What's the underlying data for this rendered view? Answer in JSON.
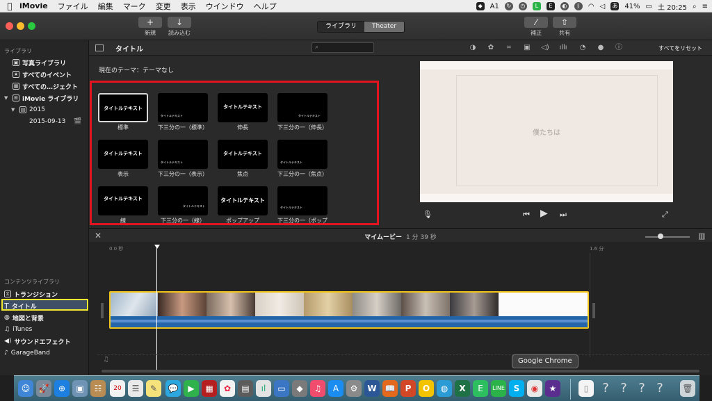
{
  "menubar": {
    "app": "iMovie",
    "items": [
      "ファイル",
      "編集",
      "マーク",
      "変更",
      "表示",
      "ウインドウ",
      "ヘルプ"
    ],
    "status_text": "A1",
    "battery": "41%",
    "clock": "土 20:25",
    "input_mode": "あ"
  },
  "toolbar": {
    "new_label": "新規",
    "import_label": "読み込む",
    "seg_library": "ライブラリ",
    "seg_theater": "Theater",
    "enhance_label": "補正",
    "share_label": "共有"
  },
  "sidebar": {
    "library_header": "ライブラリ",
    "items": [
      {
        "label": "写真ライブラリ"
      },
      {
        "label": "すべてのイベント"
      },
      {
        "label": "すべての…ジェクト"
      },
      {
        "label": "iMovie ライブラリ"
      },
      {
        "label": "2015"
      },
      {
        "label": "2015-09-13"
      }
    ],
    "content_header": "コンテンツライブラリ",
    "content_items": [
      {
        "label": "トランジション"
      },
      {
        "label": "タイトル"
      },
      {
        "label": "地図と背景"
      },
      {
        "label": "iTunes"
      },
      {
        "label": "サウンドエフェクト"
      },
      {
        "label": "GarageBand"
      }
    ]
  },
  "browser": {
    "title": "タイトル",
    "theme_label": "現在のテーマ：テーマなし",
    "tiles": [
      {
        "caption": "標準",
        "text": "タイトルテキスト"
      },
      {
        "caption": "下三分の一（標準）",
        "text": "タイトルテキスト"
      },
      {
        "caption": "伸長",
        "text": "タイトルテキスト"
      },
      {
        "caption": "下三分の一（伸長）",
        "text": "タイトルテキスト"
      },
      {
        "caption": "表示",
        "text": "タイトルテキスト"
      },
      {
        "caption": "下三分の一（表示）",
        "text": "タイトルテキスト"
      },
      {
        "caption": "焦点",
        "text": "タイトルテキスト"
      },
      {
        "caption": "下三分の一（焦点）",
        "text": "タイトルテキスト"
      },
      {
        "caption": "線",
        "text": "タイトルテキスト"
      },
      {
        "caption": "下三分の一（線）",
        "text": "タイトルテキスト"
      },
      {
        "caption": "ポップアップ",
        "text": "タイトルテキスト"
      },
      {
        "caption": "下三分の一（ポップ",
        "text": "タイトルテキスト"
      }
    ]
  },
  "viewer": {
    "reset_label": "すべてをリセット",
    "frame_caption": "僕たちは"
  },
  "timeline": {
    "title": "マイムービー",
    "duration": "1 分 39 秒",
    "ruler_start": "0.0 秒",
    "ruler_end": "1.6 分"
  },
  "dock": {
    "tooltip": "Google Chrome",
    "calendar_day": "20"
  },
  "colors": {
    "highlight_yellow": "#f1e831",
    "red_box": "#e2141f",
    "clip_border": "#f3c51a",
    "audio_blue": "#2464a8"
  }
}
